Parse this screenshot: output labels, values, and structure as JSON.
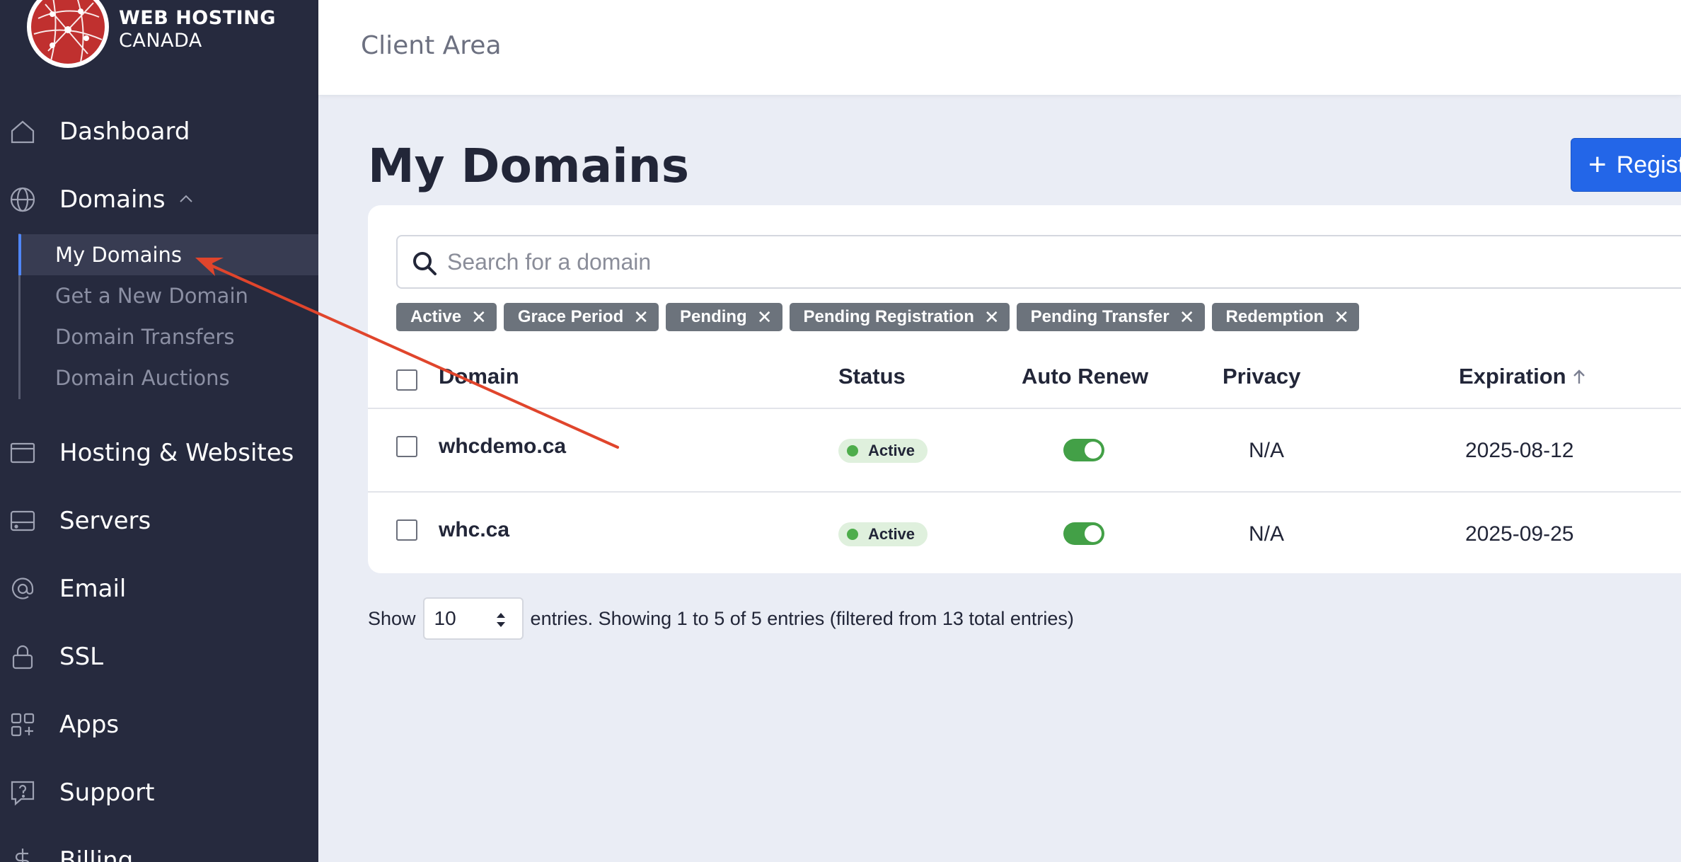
{
  "brand": {
    "line1": "WEB HOSTING",
    "line2": "CANADA"
  },
  "header": {
    "title": "Client Area"
  },
  "sidebar": {
    "items": [
      {
        "label": "Dashboard",
        "icon": "home-icon"
      },
      {
        "label": "Domains",
        "icon": "globe-icon",
        "expanded": true
      },
      {
        "label": "Hosting & Websites",
        "icon": "browser-window-icon"
      },
      {
        "label": "Servers",
        "icon": "server-icon"
      },
      {
        "label": "Email",
        "icon": "at-sign-icon"
      },
      {
        "label": "SSL",
        "icon": "lock-icon"
      },
      {
        "label": "Apps",
        "icon": "apps-grid-icon"
      },
      {
        "label": "Support",
        "icon": "help-chat-icon"
      },
      {
        "label": "Billing",
        "icon": "dollar-icon"
      }
    ],
    "domains_sub": [
      {
        "label": "My Domains",
        "active": true
      },
      {
        "label": "Get a New Domain"
      },
      {
        "label": "Domain Transfers"
      },
      {
        "label": "Domain Auctions"
      }
    ]
  },
  "main": {
    "title": "My Domains",
    "register_label": "Regist",
    "search_placeholder": "Search for a domain",
    "filters": [
      "Active",
      "Grace Period",
      "Pending",
      "Pending Registration",
      "Pending Transfer",
      "Redemption"
    ],
    "columns": {
      "domain": "Domain",
      "status": "Status",
      "auto_renew": "Auto Renew",
      "privacy": "Privacy",
      "expiration": "Expiration"
    },
    "rows": [
      {
        "domain": "whcdemo.ca",
        "status": "Active",
        "auto_renew": true,
        "privacy": "N/A",
        "expiration": "2025-08-12"
      },
      {
        "domain": "whc.ca",
        "status": "Active",
        "auto_renew": true,
        "privacy": "N/A",
        "expiration": "2025-09-25"
      }
    ]
  },
  "footer": {
    "show_label": "Show",
    "entries_value": "10",
    "entries_text": "entries. Showing 1 to 5 of 5 entries (filtered from 13 total entries)"
  },
  "colors": {
    "sidebar_bg": "#262a3e",
    "accent_blue": "#2366e8",
    "active_green": "#43a047",
    "annotation_red": "#e0452c"
  }
}
